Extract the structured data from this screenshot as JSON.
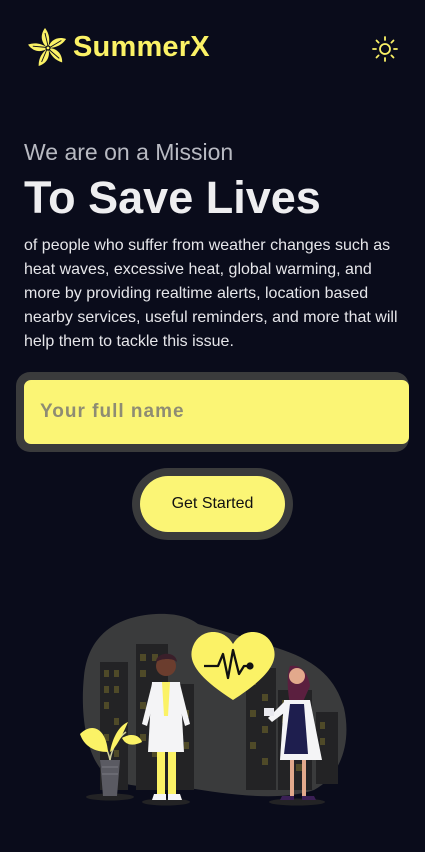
{
  "header": {
    "brand": "SummerX",
    "logo_icon": "flower-icon",
    "theme_icon": "sun-icon"
  },
  "hero": {
    "kicker": "We are on a Mission",
    "title": "To Save Lives",
    "description": "of people who suffer from weather changes such as heat waves, excessive heat, global warming, and more by providing realtime alerts, location based nearby services, useful reminders, and more that will help them to tackle this issue."
  },
  "form": {
    "name_placeholder": "Your full name",
    "name_value": "",
    "cta_label": "Get Started"
  },
  "illustration": {
    "icon": "doctors-heartbeat-illustration"
  },
  "colors": {
    "background": "#0a0c1b",
    "accent": "#fbf575",
    "brand_text": "#fbf266",
    "frame": "#3a3b3c"
  }
}
